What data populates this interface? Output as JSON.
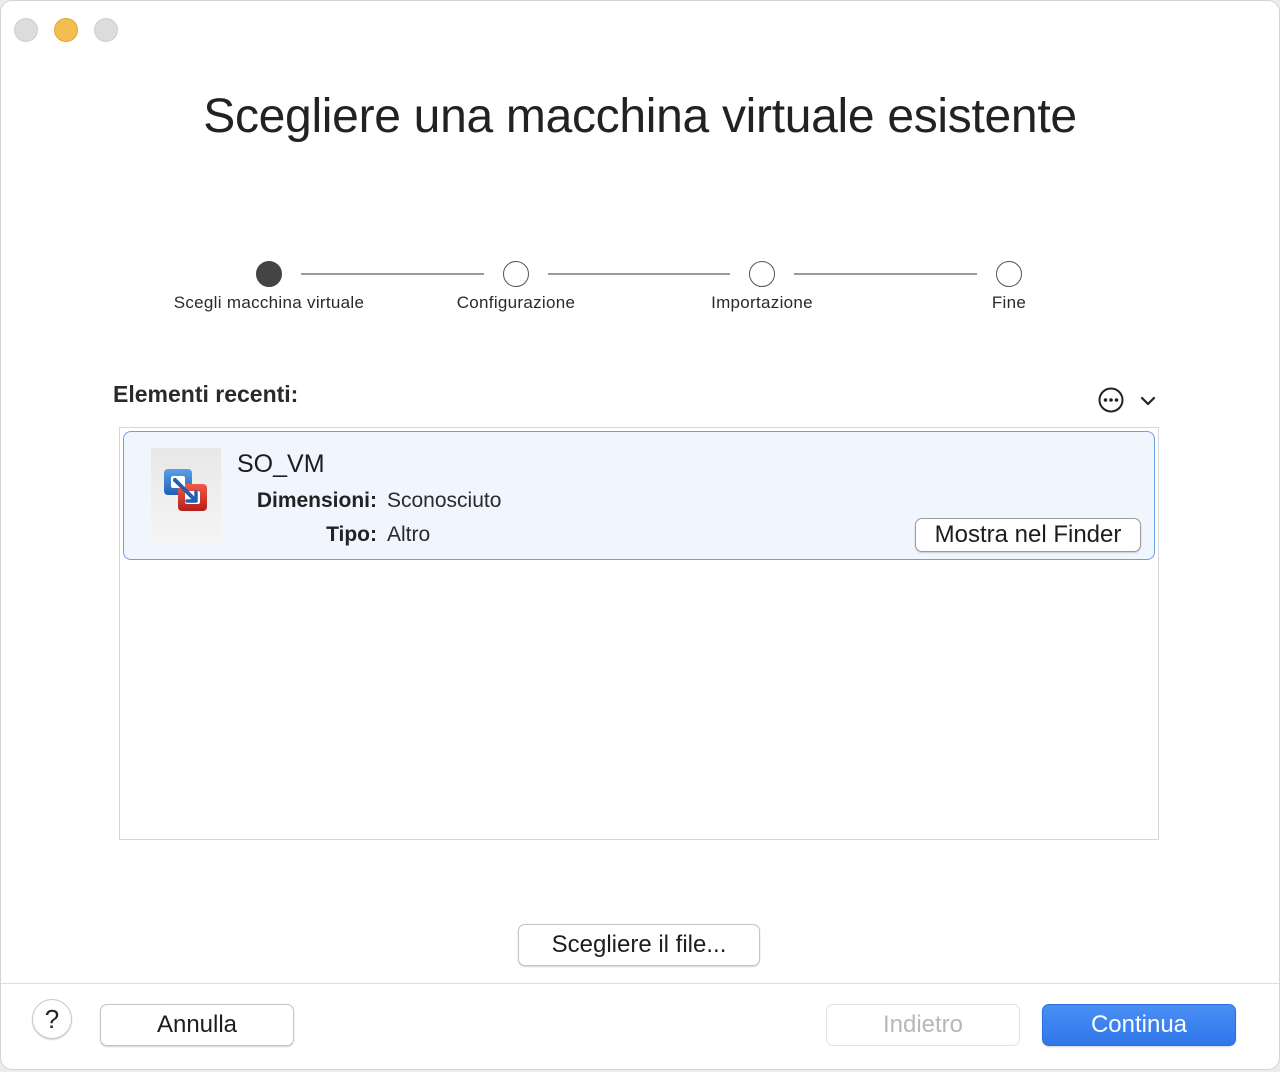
{
  "window": {
    "title": "Scegliere una macchina virtuale esistente"
  },
  "stepper": {
    "steps": [
      {
        "label": "Scegli macchina virtuale",
        "active": true
      },
      {
        "label": "Configurazione",
        "active": false
      },
      {
        "label": "Importazione",
        "active": false
      },
      {
        "label": "Fine",
        "active": false
      }
    ]
  },
  "recent": {
    "title": "Elementi recenti:",
    "options_icon": "ellipsis-circle-icon",
    "chevron_icon": "chevron-down-icon",
    "items": [
      {
        "name": "SO_VM",
        "icon": "vmware-fusion-icon",
        "size_label": "Dimensioni:",
        "size_value": "Sconosciuto",
        "type_label": "Tipo:",
        "type_value": "Altro",
        "finder_button": "Mostra nel Finder",
        "selected": true
      }
    ]
  },
  "actions": {
    "choose_file": "Scegliere il file...",
    "help": "?",
    "cancel": "Annulla",
    "back": "Indietro",
    "continue": "Continua"
  },
  "colors": {
    "accent": "#3b82f0",
    "selection_border": "#6b9ef0",
    "selection_bg": "#f1f6fe",
    "minimize": "#f4bd4f"
  }
}
